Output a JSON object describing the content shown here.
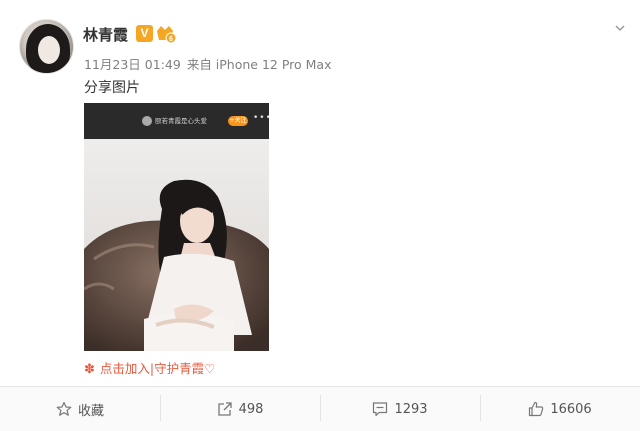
{
  "post": {
    "username": "林青霞",
    "verify_badge": "V",
    "timestamp": "11月23日 01:49",
    "source": "来自 iPhone 12 Pro Max",
    "text": "分享图片",
    "image_topbar_text": "颐若青霞是心头爱",
    "image_topbar_pill": "+关注",
    "overlay_link_text": "点击加入|守护青霞♡"
  },
  "actions": {
    "favorite_label": "收藏",
    "repost_count": "498",
    "comment_count": "1293",
    "like_count": "16606"
  },
  "icons": {
    "menu": "chevron-down-icon",
    "favorite": "star-icon",
    "repost": "share-icon",
    "comment": "comment-icon",
    "like": "thumbs-up-icon",
    "flower": "flower-icon"
  },
  "colors": {
    "verify_badge": "#f5a623",
    "link": "#e8583c",
    "meta_text": "#808080"
  }
}
